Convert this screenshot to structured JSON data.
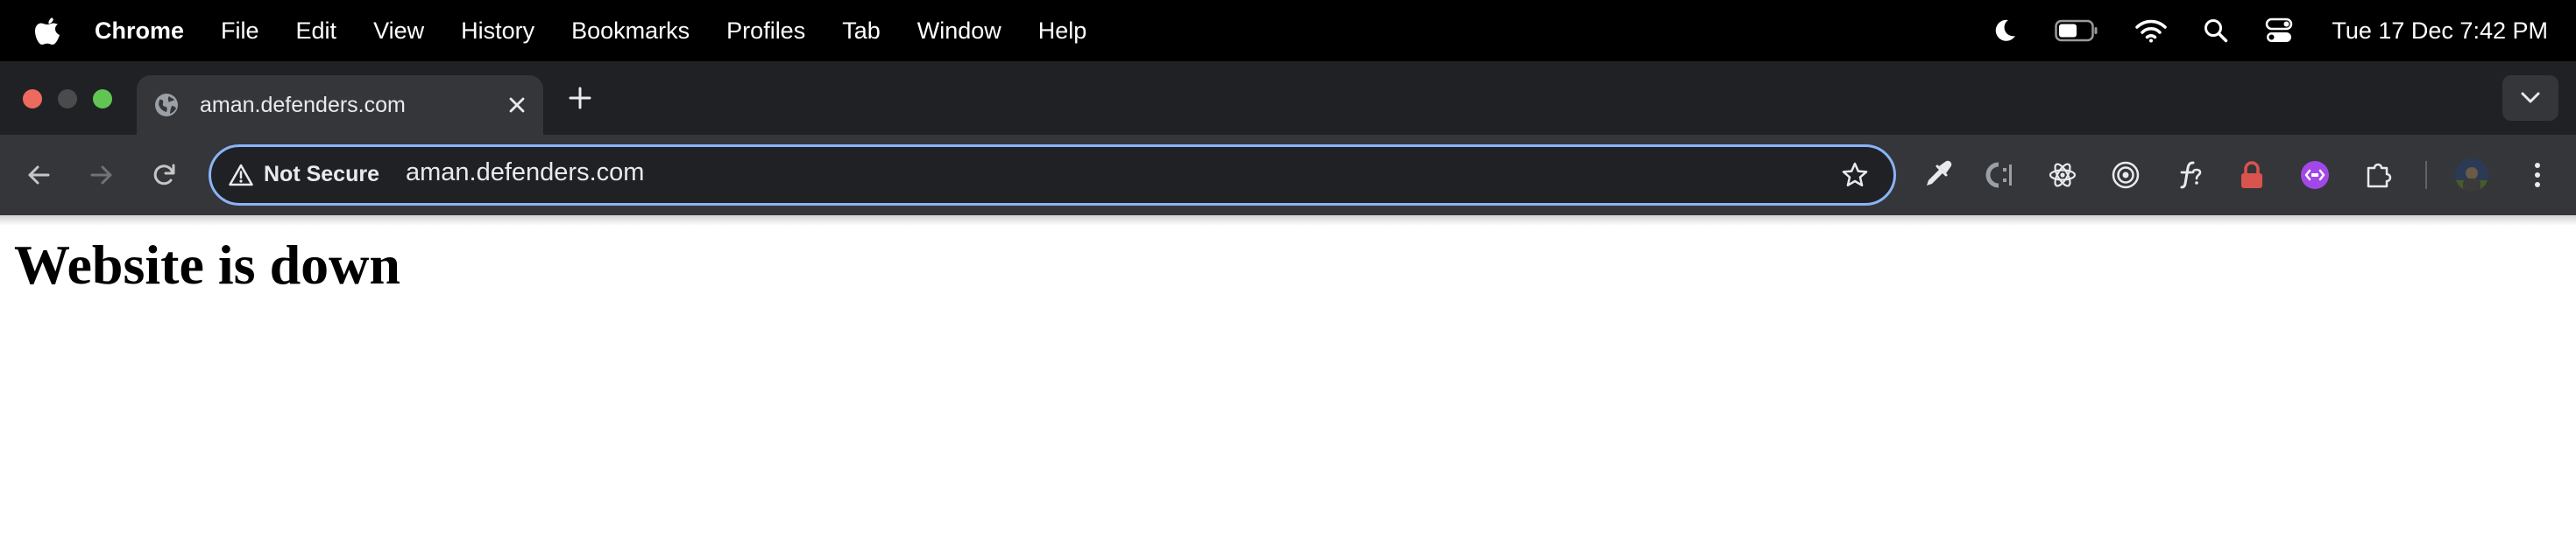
{
  "menubar": {
    "app_name": "Chrome",
    "items": [
      "File",
      "Edit",
      "View",
      "History",
      "Bookmarks",
      "Profiles",
      "Tab",
      "Window",
      "Help"
    ],
    "clock": "Tue 17 Dec  7:42 PM",
    "status_icons": [
      "moon-icon",
      "battery-icon",
      "wifi-icon",
      "spotlight-search-icon",
      "control-center-icon"
    ]
  },
  "tab": {
    "title": "aman.defenders.com",
    "favicon": "globe-icon"
  },
  "omnibox": {
    "security_label": "Not Secure",
    "url": "aman.defenders.com"
  },
  "extensions": [
    "eyedropper-icon",
    "css-inspector-icon",
    "react-devtools-icon",
    "target-icon",
    "font-identifier-icon",
    "password-manager-icon",
    "purple-extension-icon",
    "puzzle-piece-icon"
  ],
  "colors": {
    "accent": "#8ab4f8",
    "tab_active": "#35363a",
    "tabstrip": "#202124",
    "close_red": "#ed6a5e",
    "zoom_green": "#61c554"
  },
  "page": {
    "heading": "Website is down"
  }
}
